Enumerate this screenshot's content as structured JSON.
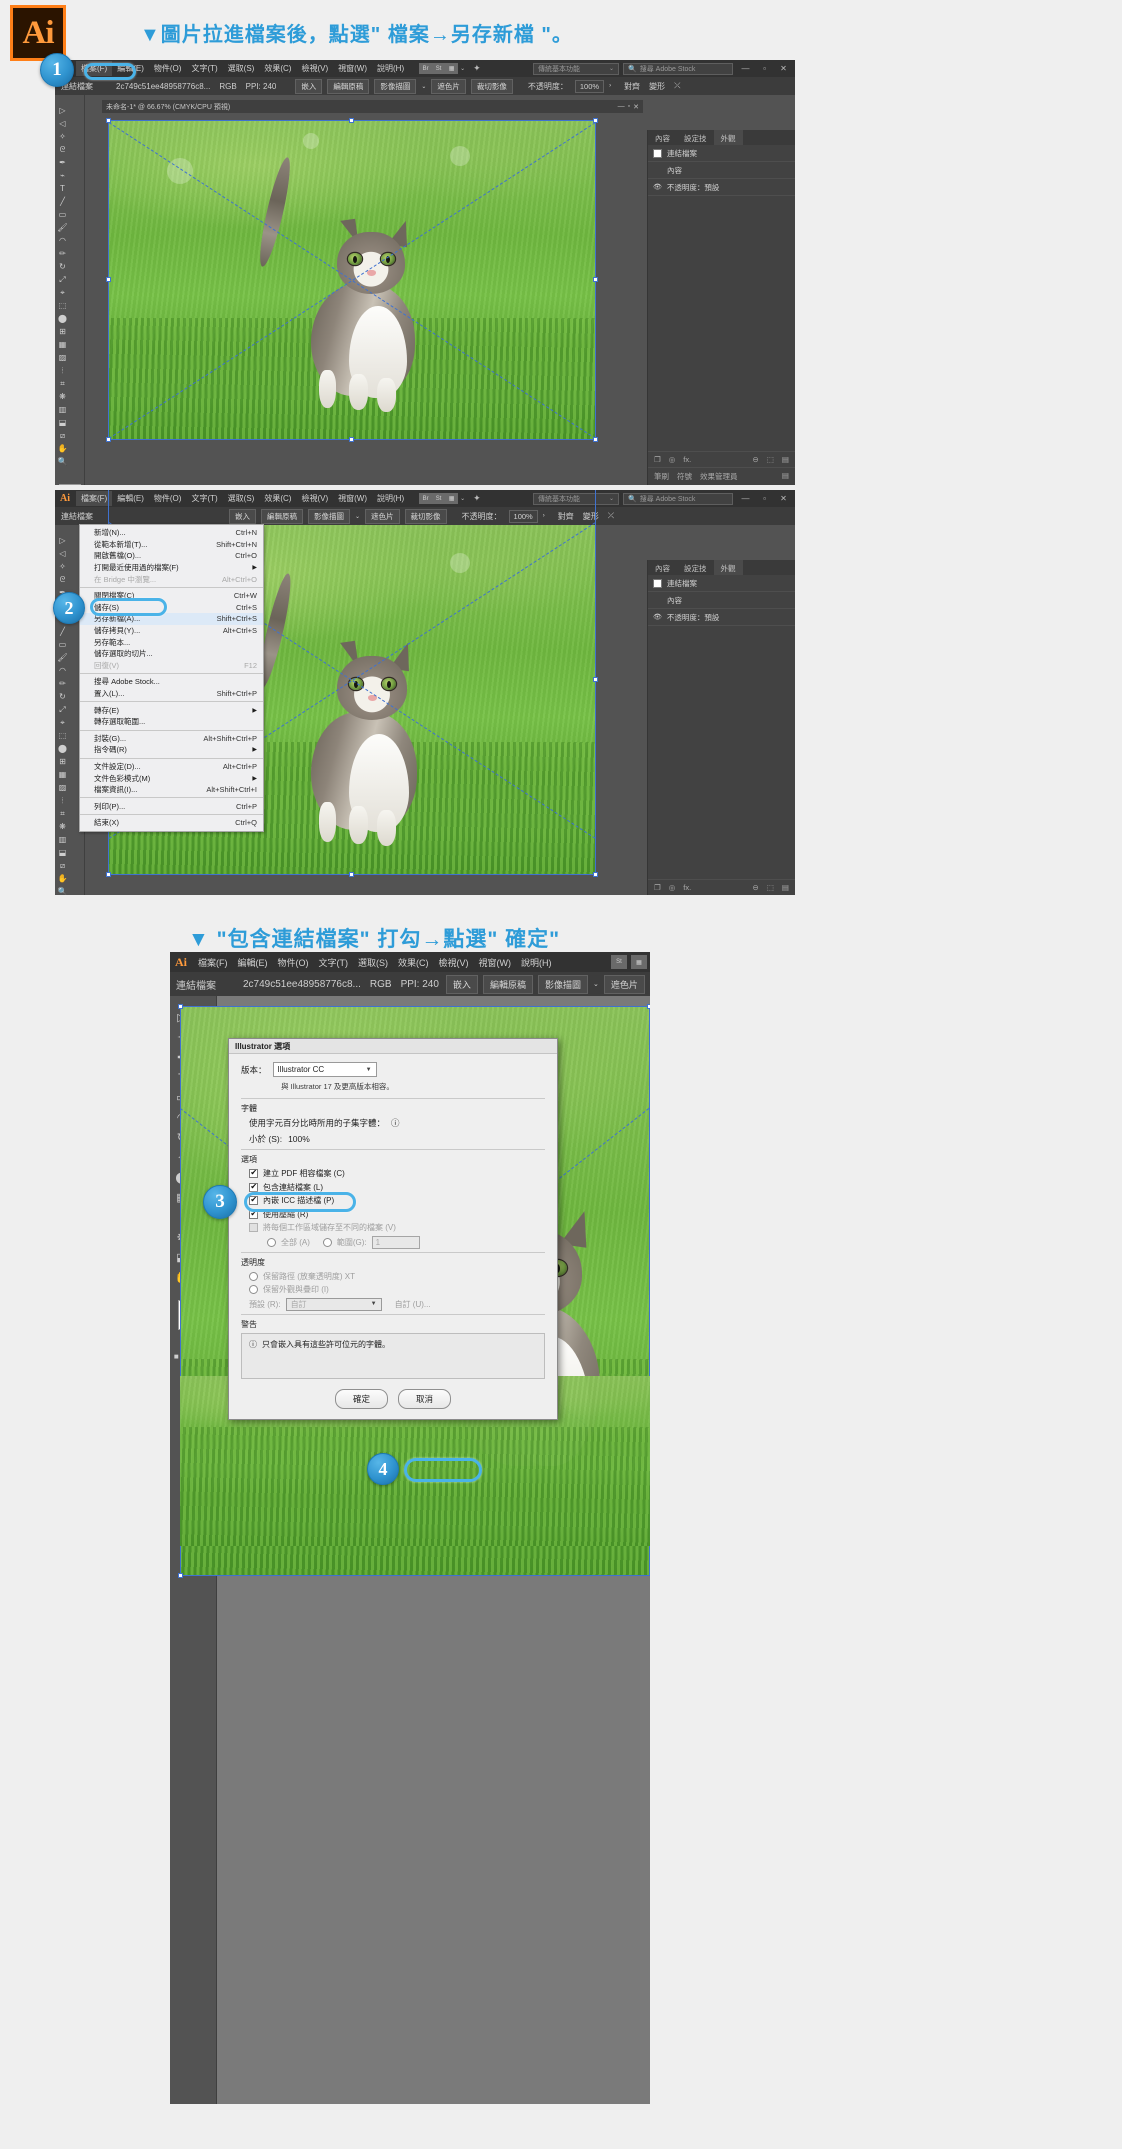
{
  "app": {
    "logo_text": "Ai"
  },
  "headings": {
    "step1": "▼圖片拉進檔案後，點選\" 檔案→另存新檔 \"。",
    "step3": "▼ \"包含連結檔案\" 打勾→點選\" 確定\""
  },
  "menubar": {
    "ai_mark": "Ai",
    "items": [
      {
        "label": "檔案(F)"
      },
      {
        "label": "編輯(E)"
      },
      {
        "label": "物件(O)"
      },
      {
        "label": "文字(T)"
      },
      {
        "label": "選取(S)"
      },
      {
        "label": "效果(C)"
      },
      {
        "label": "檢視(V)"
      },
      {
        "label": "視窗(W)"
      },
      {
        "label": "說明(H)"
      }
    ],
    "bridge_btn": "Br",
    "stock_btn": "St",
    "arrange_btn": "▦",
    "chevron": "⌄",
    "brush_icon": "✦",
    "workspace_label": "傳統基本功能",
    "search_icon": "search-icon",
    "search_placeholder": "搜尋 Adobe Stock",
    "window_buttons": [
      "—",
      "▫",
      "✕"
    ]
  },
  "controlbar": {
    "type_label": "連結檔案",
    "filename": "2c749c51ee48958776c8...",
    "colormode": "RGB",
    "ppi": "PPI: 240",
    "embed": "嵌入",
    "edit_original": "編輯原稿",
    "image_trace": "影像描圖",
    "trace_chevron": "⌄",
    "mask": "遮色片",
    "crop_image": "裁切影像",
    "opacity_label": "不透明度：",
    "opacity_value": "100%",
    "opacity_chevron": "›",
    "align": "對齊",
    "transform": "變形",
    "extra_icon": "⤫"
  },
  "document": {
    "title": "未命名-1* @ 66.67% (CMYK/CPU 預視)",
    "buttons": [
      "—",
      "▫",
      "✕"
    ]
  },
  "rightpanel": {
    "tabs": [
      {
        "label": "內容"
      },
      {
        "label": "設定技"
      },
      {
        "label": "外觀",
        "active": true
      }
    ],
    "rows": [
      {
        "label": "連結檔案"
      },
      {
        "label": "內容"
      },
      {
        "label": "不透明度：預設"
      }
    ],
    "footer_left": [
      "❐",
      "◎",
      "fx."
    ],
    "footer_right": [
      "⊖",
      "⬚",
      "▤"
    ],
    "bottom_tabs": [
      "筆刷",
      "符號",
      "效果管理員"
    ]
  },
  "file_menu": {
    "items": [
      {
        "label": "新增(N)...",
        "shortcut": "Ctrl+N"
      },
      {
        "label": "從範本新增(T)...",
        "shortcut": "Shift+Ctrl+N"
      },
      {
        "label": "開啟舊檔(O)...",
        "shortcut": "Ctrl+O"
      },
      {
        "label": "打開最近使用過的檔案(F)",
        "submenu": true
      },
      {
        "label": "在 Bridge 中瀏覽...",
        "shortcut": "Alt+Ctrl+O",
        "disabled": true
      },
      {
        "separator": true
      },
      {
        "label": "關閉檔案(C)",
        "shortcut": "Ctrl+W"
      },
      {
        "label": "儲存(S)",
        "shortcut": "Ctrl+S"
      },
      {
        "label": "另存新檔(A)...",
        "shortcut": "Shift+Ctrl+S",
        "highlight": true
      },
      {
        "label": "儲存拷貝(Y)...",
        "shortcut": "Alt+Ctrl+S"
      },
      {
        "label": "另存範本..."
      },
      {
        "label": "儲存選取的切片..."
      },
      {
        "label": "回復(V)",
        "shortcut": "F12",
        "disabled": true
      },
      {
        "separator": true
      },
      {
        "label": "搜尋 Adobe Stock..."
      },
      {
        "label": "置入(L)...",
        "shortcut": "Shift+Ctrl+P"
      },
      {
        "separator": true
      },
      {
        "label": "轉存(E)",
        "submenu": true
      },
      {
        "label": "轉存選取範圍..."
      },
      {
        "separator": true
      },
      {
        "label": "封裝(G)...",
        "shortcut": "Alt+Shift+Ctrl+P"
      },
      {
        "label": "指令碼(R)",
        "submenu": true
      },
      {
        "separator": true
      },
      {
        "label": "文件設定(D)...",
        "shortcut": "Alt+Ctrl+P"
      },
      {
        "label": "文件色彩模式(M)",
        "submenu": true
      },
      {
        "label": "檔案資訊(I)...",
        "shortcut": "Alt+Shift+Ctrl+I"
      },
      {
        "separator": true
      },
      {
        "label": "列印(P)...",
        "shortcut": "Ctrl+P"
      },
      {
        "separator": true
      },
      {
        "label": "結束(X)",
        "shortcut": "Ctrl+Q"
      }
    ]
  },
  "dialog": {
    "title": "Illustrator 選項",
    "version_label": "版本：",
    "version_value": "Illustrator CC",
    "version_note": "與 Illustrator 17 及更高版本相容。",
    "fonts_group": "字體",
    "fonts_note": "使用字元百分比時所用的子集字體：",
    "fonts_info_icon": "ⓘ",
    "subset_label": "小於 (S):",
    "subset_value": "100%",
    "options_group": "選項",
    "checkboxes": [
      {
        "label": "建立 PDF 相容檔案 (C)",
        "checked": true
      },
      {
        "label": "包含連結檔案 (L)",
        "checked": true,
        "highlight": true
      },
      {
        "label": "內嵌 ICC 描述檔 (P)",
        "checked": true
      },
      {
        "label": "使用壓縮 (R)",
        "checked": true
      },
      {
        "label": "將每個工作區域儲存至不同的檔案 (V)",
        "checked": false,
        "disabled": true
      }
    ],
    "radio_all": "全部 (A)",
    "radio_range": "範圍(G):",
    "range_value": "1",
    "transparency_group": "透明度",
    "radio_preserve": "保留路徑 (放棄透明度) XT",
    "radio_keep": "保留外觀與疊印 (I)",
    "preset_label": "預設 (R):",
    "preset_value": "自訂",
    "custom_btn": "自訂 (U)...",
    "warning_group": "警告",
    "warning_icon": "ⓘ",
    "warning_text": "只會嵌入具有這些許可位元的字體。",
    "ok_button": "確定",
    "cancel_button": "取消"
  },
  "callouts": [
    {
      "number": "1"
    },
    {
      "number": "2"
    },
    {
      "number": "3"
    },
    {
      "number": "4"
    }
  ],
  "panel3": {
    "menubar_items": [
      "檔案(F)",
      "編輯(E)",
      "物件(O)",
      "文字(T)",
      "選取(S)",
      "效果(C)",
      "檢視(V)",
      "視窗(W)",
      "說明(H)"
    ]
  },
  "colors": {
    "accent": "#2e9cd8",
    "ui_dark": "#535353",
    "ui_darker": "#323232",
    "logo_orange": "#ff7f18",
    "selection_blue": "#3f72d0"
  }
}
